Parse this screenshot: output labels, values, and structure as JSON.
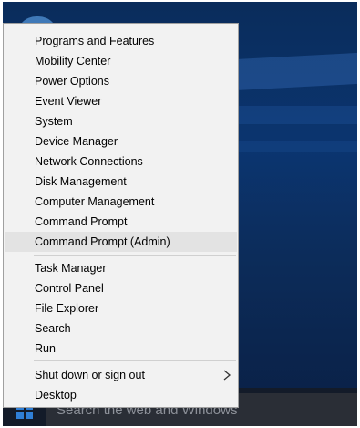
{
  "menu": {
    "group1": [
      {
        "label": "Programs and Features"
      },
      {
        "label": "Mobility Center"
      },
      {
        "label": "Power Options"
      },
      {
        "label": "Event Viewer"
      },
      {
        "label": "System"
      },
      {
        "label": "Device Manager"
      },
      {
        "label": "Network Connections"
      },
      {
        "label": "Disk Management"
      },
      {
        "label": "Computer Management"
      },
      {
        "label": "Command Prompt"
      },
      {
        "label": "Command Prompt (Admin)"
      }
    ],
    "group2": [
      {
        "label": "Task Manager"
      },
      {
        "label": "Control Panel"
      },
      {
        "label": "File Explorer"
      },
      {
        "label": "Search"
      },
      {
        "label": "Run"
      }
    ],
    "group3": [
      {
        "label": "Shut down or sign out"
      },
      {
        "label": "Desktop"
      }
    ]
  },
  "taskbar": {
    "search_placeholder": "Search the web and Windows",
    "start_icon": "windows-logo-icon"
  },
  "colors": {
    "menu_bg": "#f2f2f2",
    "hover_bg": "#e3e3e3",
    "taskbar_bg": "#131b29",
    "desktop_bg": "#0b3570"
  }
}
